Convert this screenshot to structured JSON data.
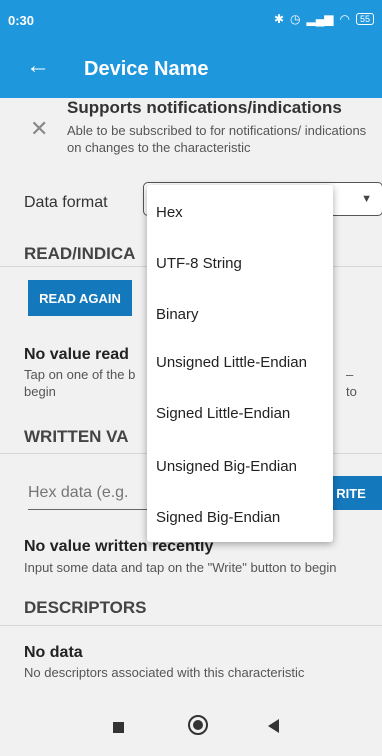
{
  "status_bar": {
    "time": "0:30",
    "icons": [
      "bluetooth-icon",
      "alarm-icon",
      "signal-icon",
      "wifi-icon"
    ],
    "battery": "55"
  },
  "app_bar": {
    "title": "Device Name",
    "back_icon": "arrow-left-icon"
  },
  "notifications": {
    "title": "Supports notifications/indications",
    "description": "Able to be subscribed to for notifications/ indications on changes to the characteristic",
    "icon": "close-icon"
  },
  "data_format": {
    "label": "Data format",
    "selected": ""
  },
  "read_section": {
    "heading": "READ/INDICA",
    "button": "READ AGAIN",
    "no_value_title": "No value read",
    "no_value_desc_left": "Tap on one of the b",
    "no_value_desc_right": "– to",
    "no_value_desc_line2": "begin"
  },
  "written_section": {
    "heading": "WRITTEN VA",
    "input_placeholder": "Hex data (e.g.",
    "write_button": "RITE",
    "no_value_title": "No value written recently",
    "no_value_desc": "Input some data and tap on the \"Write\" button to begin"
  },
  "descriptors": {
    "heading": "DESCRIPTORS",
    "no_data_title": "No data",
    "no_data_desc": "No descriptors associated with this characteristic"
  },
  "dropdown_options": [
    "Hex",
    "UTF-8 String",
    "Binary",
    "Unsigned Little-Endian",
    "Signed Little-Endian",
    "Unsigned Big-Endian",
    "Signed Big-Endian"
  ],
  "colors": {
    "primary": "#1f97dd",
    "button": "#1478bd",
    "background": "#f1f1f1"
  }
}
